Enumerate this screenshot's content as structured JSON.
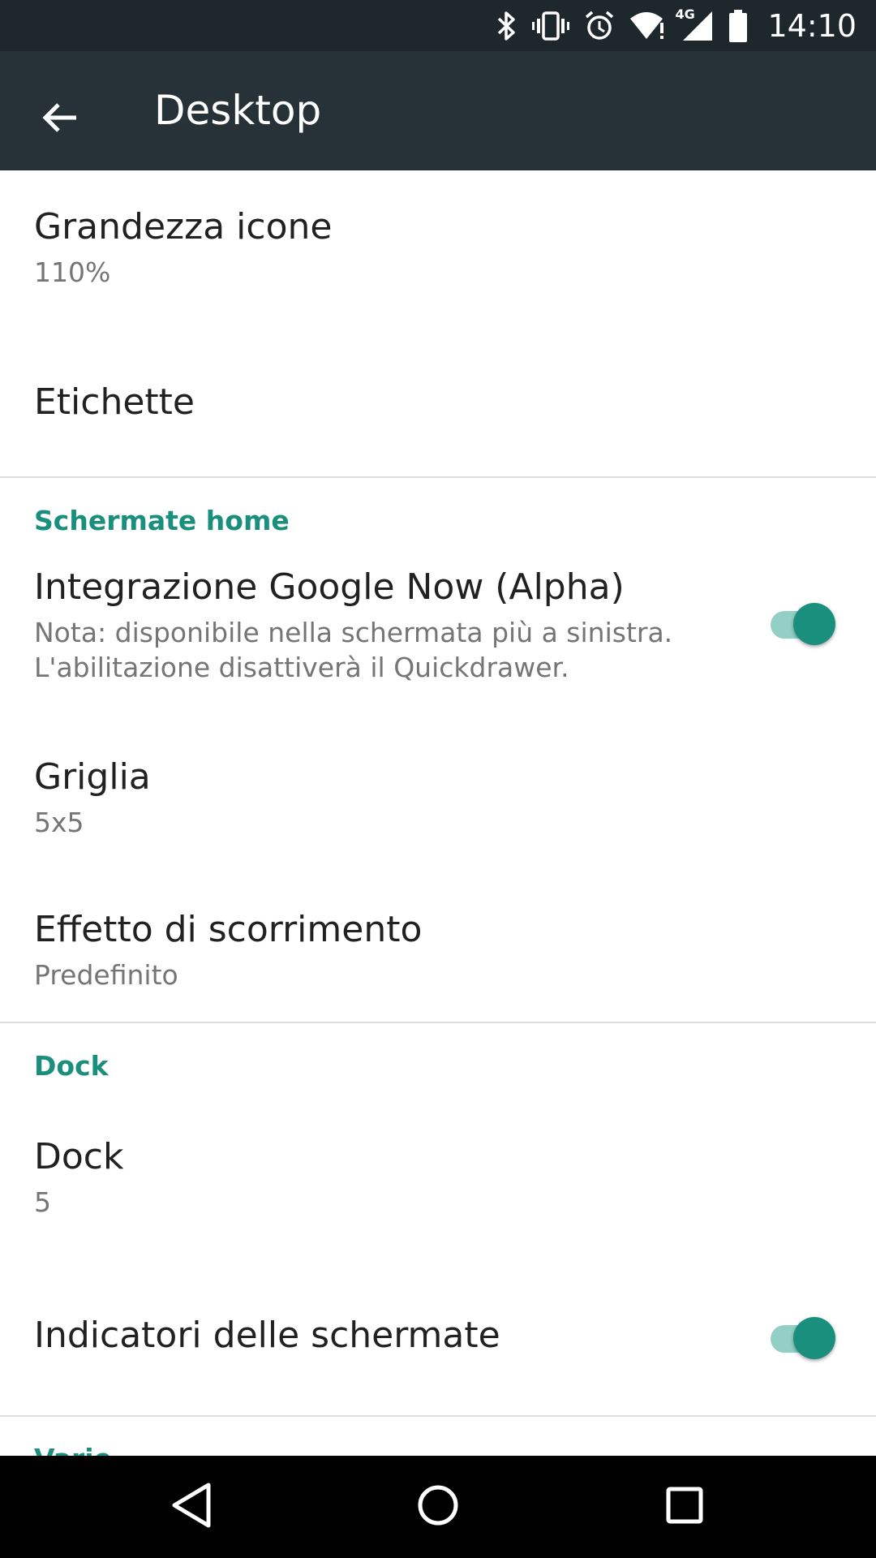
{
  "status_bar": {
    "time": "14:10",
    "network_label": "4G",
    "icons": [
      "bluetooth-icon",
      "vibrate-icon",
      "alarm-icon",
      "wifi-icon",
      "signal-icon",
      "battery-icon"
    ]
  },
  "toolbar": {
    "title": "Desktop",
    "back_icon": "arrow-back-icon"
  },
  "preferences": {
    "icon_size": {
      "title": "Grandezza icone",
      "summary": "110%"
    },
    "labels": {
      "title": "Etichette"
    },
    "home_screens_category": "Schermate home",
    "google_now": {
      "title": "Integrazione Google Now (Alpha)",
      "summary_line1": "Nota: disponibile nella schermata più a sinistra.",
      "summary_line2": "L'abilitazione disattiverà il Quickdrawer.",
      "enabled": true
    },
    "grid": {
      "title": "Griglia",
      "summary": "5x5"
    },
    "scroll_effect": {
      "title": "Effetto di scorrimento",
      "summary": "Predefinito"
    },
    "dock_category": "Dock",
    "dock": {
      "title": "Dock",
      "summary": "5"
    },
    "page_indicators": {
      "title": "Indicatori delle schermate",
      "enabled": true
    },
    "misc_category": "Varie"
  },
  "nav_bar": {
    "buttons": [
      "back-icon",
      "home-icon",
      "recents-icon"
    ]
  },
  "colors": {
    "status_bar": "#1e272c",
    "toolbar": "#263238",
    "accent": "#1b8f7e",
    "switch_track": "#93cfc6"
  }
}
